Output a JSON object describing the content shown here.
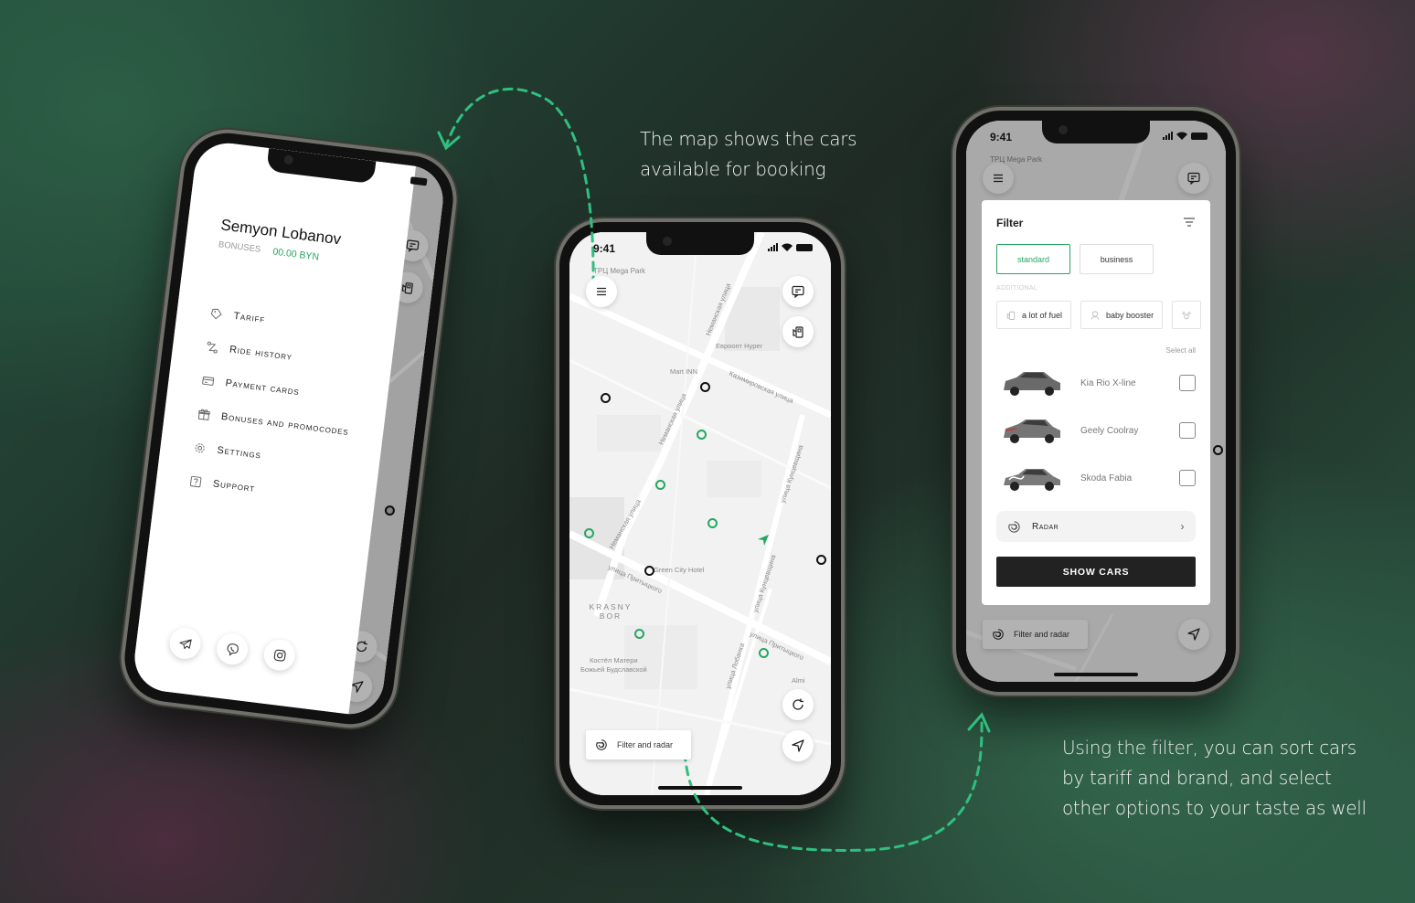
{
  "captions": {
    "map": [
      "The map shows the cars",
      "available for booking"
    ],
    "filter": [
      "Using the filter, you can sort cars",
      "by tariff and brand, and select",
      "other options to your taste as well"
    ]
  },
  "colors": {
    "accent": "#27a663",
    "dark_button": "#222222",
    "map_bg": "#f2f2f2"
  },
  "status_bar": {
    "time": "9:41"
  },
  "menu_phone": {
    "user_name": "Semyon Lobanov",
    "bonuses_label": "BONUSES",
    "bonuses_value": "00.00 BYN",
    "menu_items": [
      {
        "label": "Tariff",
        "icon": "tag-icon"
      },
      {
        "label": "Ride history",
        "icon": "route-icon"
      },
      {
        "label": "Payment cards",
        "icon": "credit-card-icon"
      },
      {
        "label": "Bonuses and promocodes",
        "icon": "gift-icon"
      },
      {
        "label": "Settings",
        "icon": "gear-icon"
      },
      {
        "label": "Support",
        "icon": "question-icon"
      }
    ],
    "socials": [
      "telegram-icon",
      "viber-icon",
      "instagram-icon"
    ],
    "map_labels": [
      "Almi"
    ]
  },
  "map_phone": {
    "location_label": "ТРЦ Mega Park",
    "map_labels": {
      "evroopt": "Евроопт Hyper",
      "mart_inn": "Mart INN",
      "green_city": "Green City Hotel",
      "krasny_bor": "KRASNY BOR",
      "kostel_1": "Костёл Матери",
      "kostel_2": "Божьей Будславской",
      "almi": "Almi",
      "nemanskaya": "Неманская улица",
      "nemanskaya2": "Неманская улица",
      "kazimirovskaya": "Казимировская улица",
      "kuntsevshchina": "улица Кунцевщина",
      "kuntsevshchina2": "улица Кунцевщина",
      "prytytskogo": "улица Притыцкого",
      "prytytskogo2": "улица Притыцкого",
      "lobanka": "улица Лобанка"
    },
    "filter_button": "Filter and radar",
    "car_pins": {
      "available_green": 7,
      "busy_black": 4
    }
  },
  "filter_phone": {
    "location_label": "ТРЦ Mega Park",
    "title": "Filter",
    "tariffs": [
      {
        "label": "standard",
        "selected": true
      },
      {
        "label": "business",
        "selected": false
      }
    ],
    "additional_label": "ADDITIONAL",
    "additional_options": [
      {
        "label": "a lot of fuel",
        "icon": "fuel-icon"
      },
      {
        "label": "baby booster",
        "icon": "baby-seat-icon"
      },
      {
        "label": "",
        "icon": "paw-icon"
      }
    ],
    "select_all": "Select all",
    "cars": [
      {
        "name": "Kia Rio X-line",
        "checked": false
      },
      {
        "name": "Geely Coolray",
        "checked": false
      },
      {
        "name": "Skoda Fabia",
        "checked": false
      }
    ],
    "radar_label": "Radar",
    "show_cars": "SHOW CARS",
    "filter_button": "Filter and radar"
  }
}
